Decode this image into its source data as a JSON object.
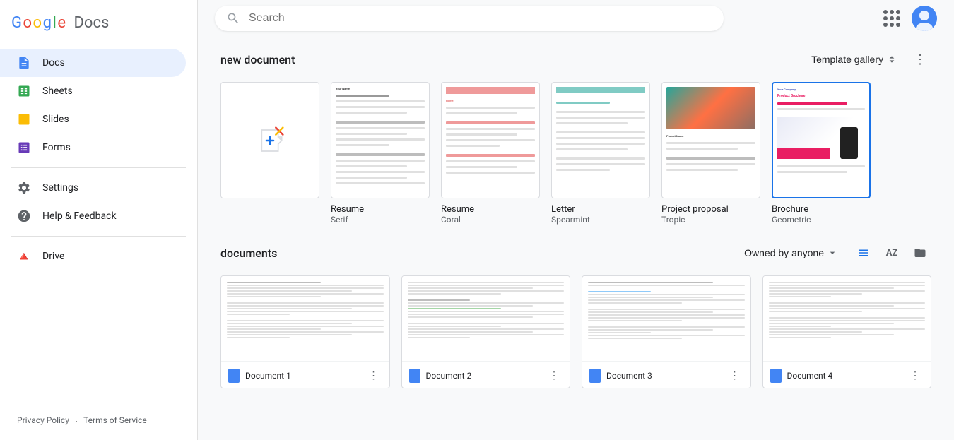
{
  "sidebar": {
    "logo_google": "Google",
    "logo_docs": "Docs",
    "nav_items": [
      {
        "id": "docs",
        "label": "Docs",
        "icon": "📄",
        "color": "#4285F4",
        "active": true
      },
      {
        "id": "sheets",
        "label": "Sheets",
        "icon": "📊",
        "color": "#34A853",
        "active": false
      },
      {
        "id": "slides",
        "label": "Slides",
        "icon": "📑",
        "color": "#FBBC05",
        "active": false
      },
      {
        "id": "forms",
        "label": "Forms",
        "icon": "📋",
        "color": "#673AB7",
        "active": false
      }
    ],
    "settings_label": "Settings",
    "help_label": "Help & Feedback",
    "drive_label": "Drive",
    "footer": {
      "privacy": "Privacy Policy",
      "separator": "·",
      "terms": "Terms of Service"
    }
  },
  "topbar": {
    "search_placeholder": "Search"
  },
  "templates": {
    "section_title": "new document",
    "gallery_btn": "Template gallery",
    "more_btn": "⋮",
    "items": [
      {
        "id": "resume-serif",
        "name": "Resume",
        "subtitle": "Serif",
        "type": "resume1"
      },
      {
        "id": "resume-coral",
        "name": "Resume",
        "subtitle": "Coral",
        "type": "resume2"
      },
      {
        "id": "letter-spearmint",
        "name": "Letter",
        "subtitle": "Spearmint",
        "type": "letter"
      },
      {
        "id": "project-tropic",
        "name": "Project proposal",
        "subtitle": "Tropic",
        "type": "project"
      },
      {
        "id": "brochure-geometric",
        "name": "Brochure",
        "subtitle": "Geometric",
        "type": "brochure"
      }
    ]
  },
  "documents": {
    "section_title": "documents",
    "owned_by": "Owned by anyone",
    "items": [
      {
        "id": 1,
        "name": "Document 1"
      },
      {
        "id": 2,
        "name": "Document 2"
      },
      {
        "id": 3,
        "name": "Document 3"
      },
      {
        "id": 4,
        "name": "Document 4"
      }
    ]
  },
  "icons": {
    "search": "🔍",
    "chevron_up_down": "⇅",
    "chevron_down": "▾",
    "grid_view": "⊞",
    "sort": "AZ",
    "folder": "📁",
    "list_view": "☰"
  }
}
